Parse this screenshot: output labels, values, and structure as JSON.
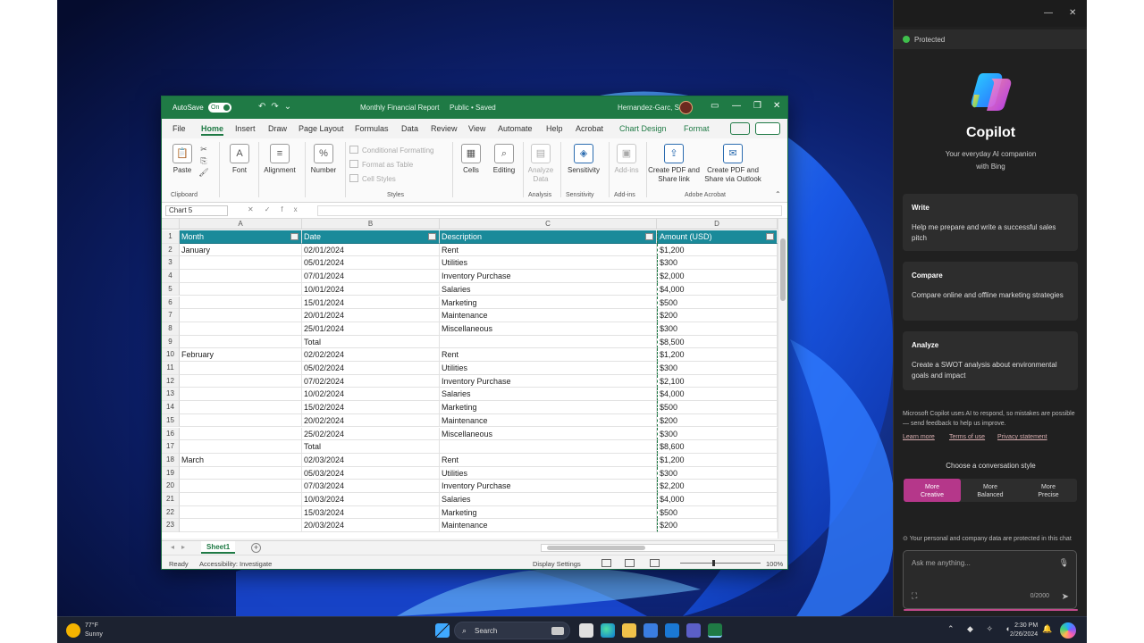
{
  "excel": {
    "title_bar": {
      "autosave_label": "AutoSave",
      "autosave_state": "On",
      "document_title": "Monthly Financial Report",
      "sensitivity": "Public • Saved",
      "user_name": "Hernandez-Garc, Sara"
    },
    "tabs": [
      "File",
      "Home",
      "Insert",
      "Draw",
      "Page Layout",
      "Formulas",
      "Data",
      "Review",
      "View",
      "Automate",
      "Help",
      "Acrobat",
      "Chart Design",
      "Format"
    ],
    "active_tab": "Home",
    "ribbon": {
      "paste": "Paste",
      "font": "Font",
      "alignment": "Alignment",
      "number": "Number",
      "conditional_formatting": "Conditional Formatting",
      "format_as_table": "Format as Table",
      "cell_styles": "Cell Styles",
      "cells": "Cells",
      "editing": "Editing",
      "analyze_data": "Analyze Data",
      "sensitivity": "Sensitivity",
      "addins": "Add-ins",
      "create_pdf_link": "Create PDF and Share link",
      "create_pdf_outlook": "Create PDF and Share via Outlook",
      "groups": {
        "clipboard": "Clipboard",
        "styles": "Styles",
        "analysis": "Analysis",
        "sensitivity": "Sensitivity",
        "addins": "Add-ins",
        "adobe": "Adobe Acrobat"
      }
    },
    "name_box": "Chart 5",
    "columns": [
      "A",
      "B",
      "C",
      "D"
    ],
    "headers": [
      "Month",
      "Date",
      "Description",
      "Amount (USD)"
    ],
    "rows": [
      [
        "January",
        "02/01/2024",
        "Rent",
        "$1,200"
      ],
      [
        "",
        "05/01/2024",
        "Utilities",
        "$300"
      ],
      [
        "",
        "07/01/2024",
        "Inventory Purchase",
        "$2,000"
      ],
      [
        "",
        "10/01/2024",
        "Salaries",
        "$4,000"
      ],
      [
        "",
        "15/01/2024",
        "Marketing",
        "$500"
      ],
      [
        "",
        "20/01/2024",
        "Maintenance",
        "$200"
      ],
      [
        "",
        "25/01/2024",
        "Miscellaneous",
        "$300"
      ],
      [
        "",
        "Total",
        "",
        "$8,500"
      ],
      [
        "February",
        "02/02/2024",
        "Rent",
        "$1,200"
      ],
      [
        "",
        "05/02/2024",
        "Utilities",
        "$300"
      ],
      [
        "",
        "07/02/2024",
        "Inventory Purchase",
        "$2,100"
      ],
      [
        "",
        "10/02/2024",
        "Salaries",
        "$4,000"
      ],
      [
        "",
        "15/02/2024",
        "Marketing",
        "$500"
      ],
      [
        "",
        "20/02/2024",
        "Maintenance",
        "$200"
      ],
      [
        "",
        "25/02/2024",
        "Miscellaneous",
        "$300"
      ],
      [
        "",
        "Total",
        "",
        "$8,600"
      ],
      [
        "March",
        "02/03/2024",
        "Rent",
        "$1,200"
      ],
      [
        "",
        "05/03/2024",
        "Utilities",
        "$300"
      ],
      [
        "",
        "07/03/2024",
        "Inventory Purchase",
        "$2,200"
      ],
      [
        "",
        "10/03/2024",
        "Salaries",
        "$4,000"
      ],
      [
        "",
        "15/03/2024",
        "Marketing",
        "$500"
      ],
      [
        "",
        "20/03/2024",
        "Maintenance",
        "$200"
      ]
    ],
    "sheet_tab": "Sheet1",
    "status": {
      "ready": "Ready",
      "accessibility": "Accessibility: Investigate",
      "display_settings": "Display Settings",
      "zoom": "100%"
    }
  },
  "copilot": {
    "protected": "Protected",
    "name": "Copilot",
    "tagline": "Your everyday AI companion",
    "with_bing": "with Bing",
    "cards": [
      {
        "title": "Write",
        "text": "Help me prepare and write a successful sales pitch"
      },
      {
        "title": "Compare",
        "text": "Compare online and offline marketing strategies"
      },
      {
        "title": "Analyze",
        "text": "Create a SWOT analysis about environmental goals and impact"
      }
    ],
    "disclaimer": "Microsoft Copilot uses AI to respond, so mistakes are possible — send feedback to help us improve.",
    "links": [
      "Learn more",
      "Terms of use",
      "Privacy statement"
    ],
    "choose_style": "Choose a conversation style",
    "styles": [
      {
        "line1": "More",
        "line2": "Creative"
      },
      {
        "line1": "More",
        "line2": "Balanced"
      },
      {
        "line1": "More",
        "line2": "Precise"
      }
    ],
    "privacy_note": "Your personal and company data are protected in this chat",
    "input_placeholder": "Ask me anything...",
    "char_count": "0/2000"
  },
  "taskbar": {
    "weather_temp": "77°F",
    "weather_desc": "Sunny",
    "search": "Search",
    "time": "2:30 PM",
    "date": "2/26/2024"
  },
  "colors": {
    "excel_green": "#1f7a45",
    "table_header": "#1a8a9a",
    "copilot_accent": "#b5378a"
  }
}
